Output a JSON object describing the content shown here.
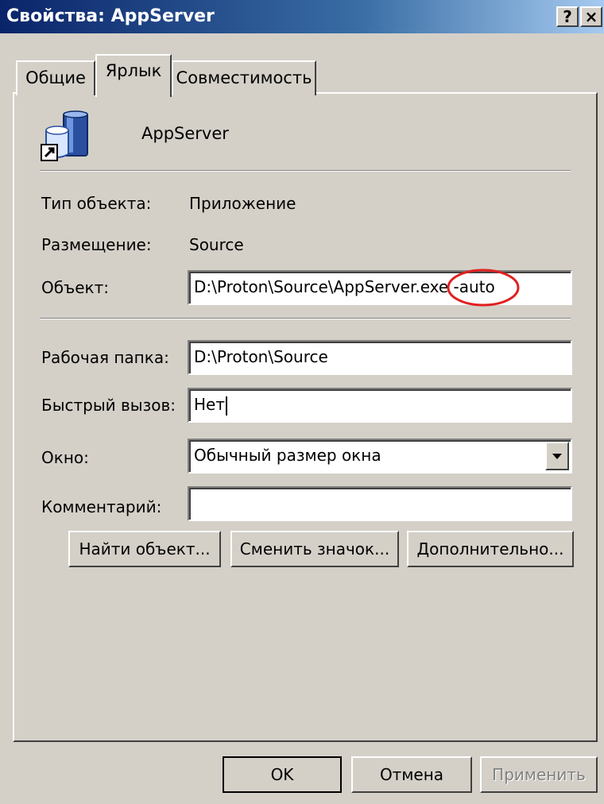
{
  "window": {
    "title": "Свойства: AppServer",
    "help_label": "?",
    "close_label": "×"
  },
  "tabs": [
    {
      "label": "Общие",
      "selected": false
    },
    {
      "label": "Ярлык",
      "selected": true
    },
    {
      "label": "Совместимость",
      "selected": false
    }
  ],
  "shortcut": {
    "name": "AppServer",
    "icon": "appserver-shortcut-icon",
    "rows": {
      "type": {
        "label": "Тип объекта:",
        "value": "Приложение"
      },
      "location": {
        "label": "Размещение:",
        "value": "Source"
      },
      "target": {
        "label": "Объект:",
        "value": "D:\\Proton\\Source\\AppServer.exe -auto"
      },
      "start_in": {
        "label": "Рабочая папка:",
        "value": "D:\\Proton\\Source"
      },
      "hotkey": {
        "label": "Быстрый вызов:",
        "value": "Нет"
      },
      "run": {
        "label": "Окно:",
        "value": "Обычный размер окна"
      },
      "comment": {
        "label": "Комментарий:",
        "value": ""
      }
    },
    "buttons": {
      "find_target": "Найти объект...",
      "change_icon": "Сменить значок...",
      "advanced": "Дополнительно..."
    }
  },
  "footer": {
    "ok": "OK",
    "cancel": "Отмена",
    "apply": "Применить"
  },
  "colors": {
    "title_gradient_start": "#0a246a",
    "dialog_face": "#d4d0c8",
    "annotation_circle": "#e02020"
  }
}
